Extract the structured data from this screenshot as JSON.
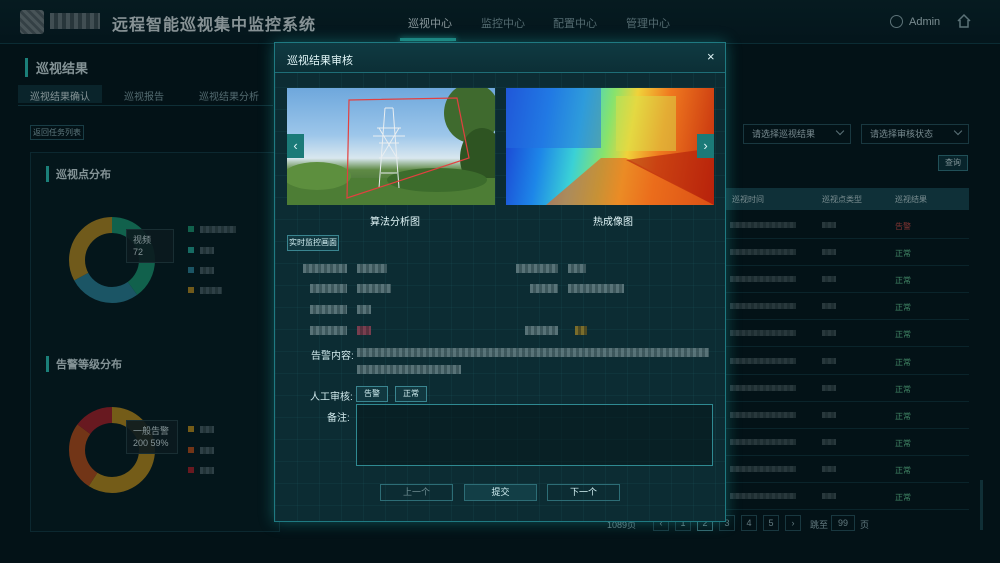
{
  "header": {
    "app_title": "远程智能巡视集中监控系统",
    "nav": [
      "巡视中心",
      "监控中心",
      "配置中心",
      "管理中心"
    ],
    "active_nav": "巡视中心",
    "user_name": "Admin"
  },
  "page": {
    "title": "巡视结果",
    "tabs": [
      "巡视结果确认",
      "巡视报告",
      "巡视结果分析"
    ],
    "back_button": "返回任务列表"
  },
  "left": {
    "section1_title": "巡视点分布",
    "donut1_tooltip": [
      "视频",
      "72"
    ],
    "donut1_colors": [
      "#1ea37b",
      "#2f8ea6",
      "#c29626"
    ],
    "donut1_values": [
      0.4,
      0.27,
      0.33
    ],
    "section2_title": "告警等级分布",
    "donut2_tooltip": [
      "一般告警",
      "200 59%"
    ],
    "donut2_colors": [
      "#c99a22",
      "#c5571f",
      "#b3262f"
    ],
    "donut2_values": [
      0.59,
      0.26,
      0.15
    ]
  },
  "right": {
    "select1": "请选择巡视结果",
    "select2": "请选择审核状态",
    "query": "查询",
    "columns": [
      "巡视时间",
      "巡视点类型",
      "巡视结果"
    ],
    "results": [
      "告警",
      "正常",
      "正常",
      "正常",
      "正常",
      "正常",
      "正常",
      "正常",
      "正常",
      "正常",
      "正常"
    ],
    "pagination": {
      "pages": [
        "1",
        "2",
        "3",
        "4",
        "5"
      ],
      "goto_label": "跳至",
      "goto_value": "99",
      "page_unit": "页"
    },
    "total_prefix": "1089页"
  },
  "modal": {
    "title": "巡视结果审核",
    "close": "×",
    "image1_caption": "算法分析图",
    "image2_caption": "热成像图",
    "live_button": "实时监控画面",
    "alarm_label": "告警内容:",
    "review_label": "人工审核:",
    "review_alarm": "告警",
    "review_normal": "正常",
    "remark_label": "备注:",
    "prev": "上一个",
    "submit": "提交",
    "next": "下一个",
    "prev_arrow": "‹",
    "next_arrow": "›"
  }
}
